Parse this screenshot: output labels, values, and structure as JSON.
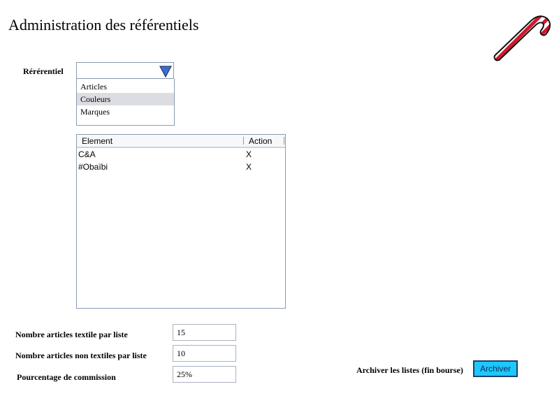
{
  "page": {
    "title": "Administration des référentiels"
  },
  "referentiel": {
    "label": "Rérérentiel",
    "selected_value": "",
    "options": [
      "Articles",
      "Couleurs",
      "Marques"
    ],
    "highlighted_index": 1
  },
  "table": {
    "columns": [
      "Element",
      "Action"
    ],
    "rows": [
      {
        "element": "C&A",
        "action": "X"
      },
      {
        "element": "#Obaïbi",
        "action": "X"
      }
    ]
  },
  "settings": {
    "textile_label": "Nombre articles textile par liste",
    "textile_value": "15",
    "non_textile_label": "Nombre articles non textiles par liste",
    "non_textile_value": "10",
    "commission_label": "Pourcentage de commission",
    "commission_value": "25%"
  },
  "archive": {
    "label": "Archiver les listes (fin bourse)",
    "button_label": "Archiver"
  },
  "icons": {
    "logo": "candy-cane-icon",
    "dropdown": "triangle-down-icon"
  },
  "colors": {
    "button_bg": "#1ec8ff",
    "button_border": "#1d3f6f",
    "dropdown_arrow": "#3b6fd1",
    "selection": "#dcdde2"
  }
}
